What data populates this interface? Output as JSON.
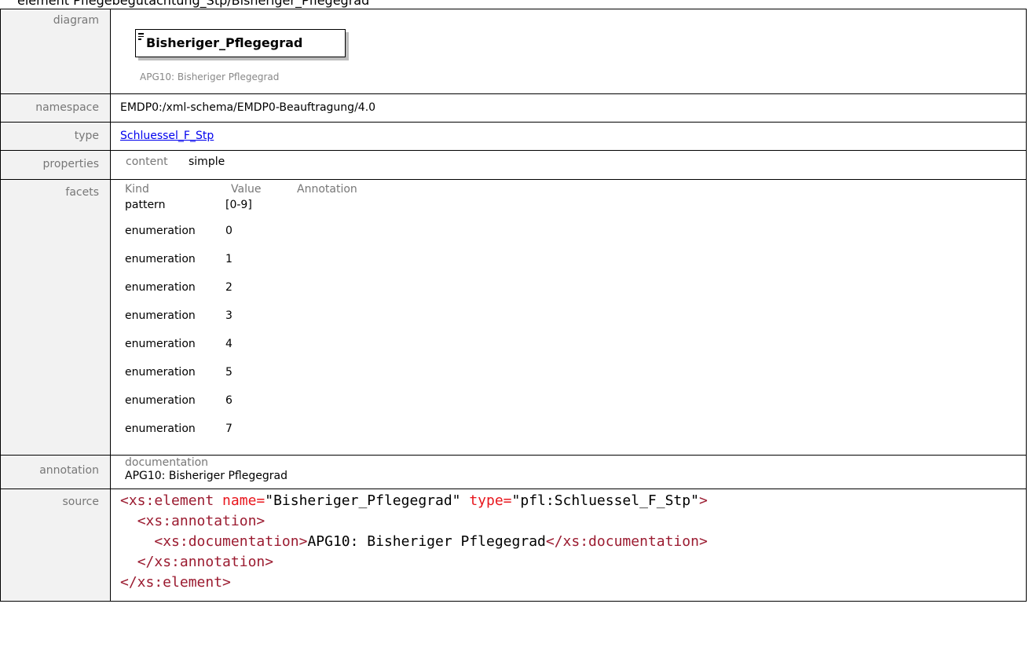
{
  "page_heading": "element Pflegebegutachtung_Stp/Bisheriger_Pflegegrad",
  "labels": {
    "diagram": "diagram",
    "namespace": "namespace",
    "type": "type",
    "properties": "properties",
    "facets": "facets",
    "annotation": "annotation",
    "source": "source"
  },
  "diagram": {
    "element_name": "Bisheriger_Pflegegrad",
    "documentation": "APG10: Bisheriger Pflegegrad",
    "icon": "element-lines-icon"
  },
  "namespace": "EMDP0:/xml-schema/EMDP0-Beauftragung/4.0",
  "type_link": "Schluessel_F_Stp",
  "properties": {
    "key": "content",
    "value": "simple"
  },
  "facets": {
    "headers": [
      "Kind",
      "Value",
      "Annotation"
    ],
    "rows": [
      {
        "kind": "pattern",
        "value": "[0-9]"
      },
      {
        "kind": "enumeration",
        "value": "0"
      },
      {
        "kind": "enumeration",
        "value": "1"
      },
      {
        "kind": "enumeration",
        "value": "2"
      },
      {
        "kind": "enumeration",
        "value": "3"
      },
      {
        "kind": "enumeration",
        "value": "4"
      },
      {
        "kind": "enumeration",
        "value": "5"
      },
      {
        "kind": "enumeration",
        "value": "6"
      },
      {
        "kind": "enumeration",
        "value": "7"
      }
    ]
  },
  "annotation": {
    "header": "documentation",
    "text": "APG10: Bisheriger Pflegegrad"
  },
  "source": {
    "line1_open": "<xs:element",
    "line1_attr1": " name=",
    "line1_val1": "\"Bisheriger_Pflegegrad\"",
    "line1_attr2": " type=",
    "line1_val2": "\"pfl:Schluessel_F_Stp\"",
    "line1_close": ">",
    "line2": "<xs:annotation>",
    "line3_open": "<xs:documentation>",
    "line3_text": "APG10: Bisheriger Pflegegrad",
    "line3_close": "</xs:documentation>",
    "line4": "</xs:annotation>",
    "line5": "</xs:element>"
  },
  "colors": {
    "tag": "#9b1b30",
    "attribute": "#e8161d",
    "link": "#0000ee",
    "label": "#777777"
  }
}
